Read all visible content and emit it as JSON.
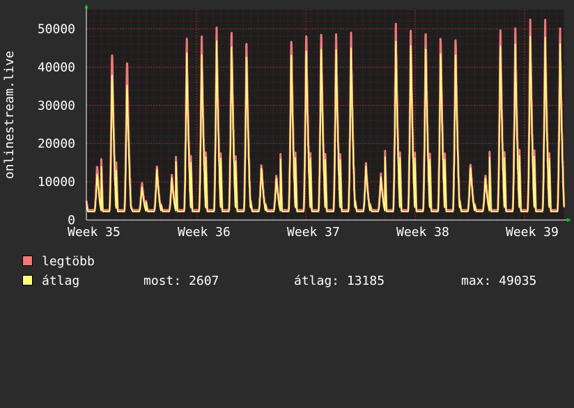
{
  "chart_data": {
    "type": "area",
    "ylabel": "onlinestream.live",
    "y_ticks": [
      0,
      10000,
      20000,
      30000,
      40000,
      50000
    ],
    "ylim": [
      0,
      55000
    ],
    "x_ticks": [
      "Week 35",
      "Week 36",
      "Week 37",
      "Week 38",
      "Week 39"
    ],
    "grid": true,
    "colors": {
      "background": "#2b2b2b",
      "plot_bg": "#1e1e1e",
      "grid": "#7a1e1e",
      "legtobb": "#f07a7a",
      "atlag": "#ffff80",
      "axis": "#ffffff",
      "arrow": "#00cc00"
    },
    "daily_peaks": {
      "legtobb": [
        14500,
        45500,
        43000,
        10000,
        14200,
        11800,
        47200,
        47800,
        50500,
        49800,
        47600,
        14800,
        12100,
        49200,
        50300,
        50000,
        49300,
        49100,
        14800,
        12100,
        51600,
        50500,
        50400,
        49600,
        49700,
        15200,
        12100,
        51000,
        50700,
        52400,
        52100,
        50000
      ],
      "atlag": [
        12500,
        40000,
        37000,
        8800,
        13500,
        11000,
        43500,
        43000,
        47000,
        46000,
        44000,
        14000,
        11300,
        45500,
        46300,
        46000,
        45200,
        45000,
        14000,
        11200,
        47000,
        46500,
        46300,
        45500,
        45600,
        14300,
        11300,
        46800,
        46500,
        48000,
        47500,
        46000
      ]
    },
    "series": [
      {
        "name": "legtöbb"
      },
      {
        "name": "átlag"
      }
    ]
  },
  "legend": {
    "items": [
      {
        "label": "legtöbb",
        "color": "#f07a7a"
      },
      {
        "label": "átlag",
        "color": "#ffff80"
      }
    ],
    "stats": {
      "most": "most: 2607",
      "atlag": "átlag: 13185",
      "max": "max: 49035"
    }
  }
}
